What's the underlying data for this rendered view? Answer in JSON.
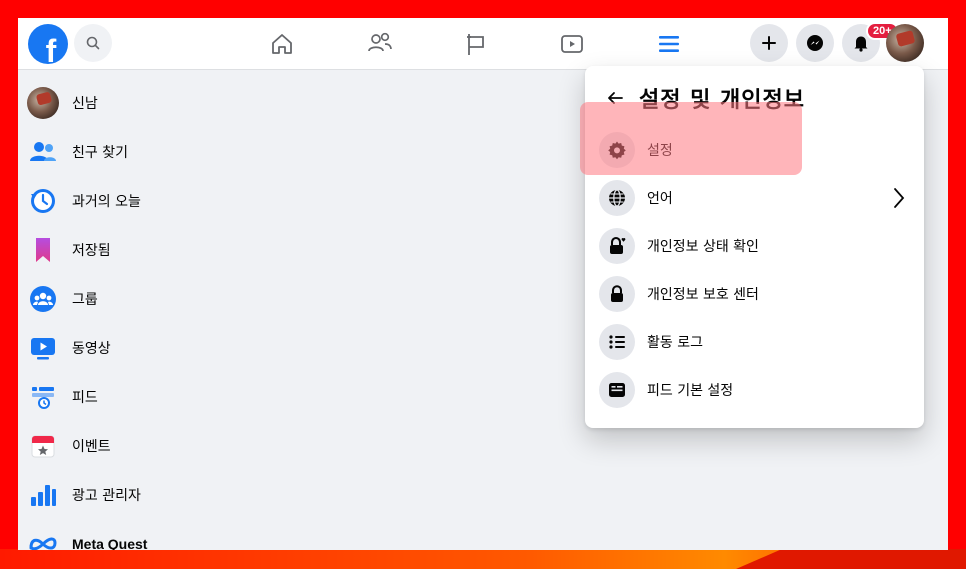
{
  "topbar": {
    "logo_letter": "f",
    "notification_badge": "20+",
    "nav": [
      "home-icon",
      "friends-icon",
      "pages-flag-icon",
      "watch-icon",
      "menu-icon"
    ],
    "actions": [
      "plus-icon",
      "messenger-icon",
      "bell-icon",
      "avatar"
    ]
  },
  "sidebar": {
    "items": [
      {
        "label": "신남",
        "icon": "avatar"
      },
      {
        "label": "친구 찾기",
        "icon": "friends-icon"
      },
      {
        "label": "과거의 오늘",
        "icon": "memories-clock-icon"
      },
      {
        "label": "저장됨",
        "icon": "bookmark-icon"
      },
      {
        "label": "그룹",
        "icon": "groups-icon"
      },
      {
        "label": "동영상",
        "icon": "video-icon"
      },
      {
        "label": "피드",
        "icon": "feeds-icon"
      },
      {
        "label": "이벤트",
        "icon": "calendar-star-icon"
      },
      {
        "label": "광고 관리자",
        "icon": "ads-bar-chart-icon"
      },
      {
        "label": "Meta Quest",
        "icon": "meta-logo-icon"
      }
    ]
  },
  "panel": {
    "title": "설정 및 개인정보",
    "items": [
      {
        "label": "설정",
        "icon": "gear-icon"
      },
      {
        "label": "언어",
        "icon": "globe-icon"
      },
      {
        "label": "개인정보 상태 확인",
        "icon": "lock-heart-icon"
      },
      {
        "label": "개인정보 보호 센터",
        "icon": "lock-icon"
      },
      {
        "label": "활동 로그",
        "icon": "list-icon"
      },
      {
        "label": "피드 기본 설정",
        "icon": "feed-prefs-icon"
      }
    ]
  },
  "colors": {
    "brand": "#1877f2",
    "highlight": "#ff7882",
    "frame": "#ff0000"
  }
}
